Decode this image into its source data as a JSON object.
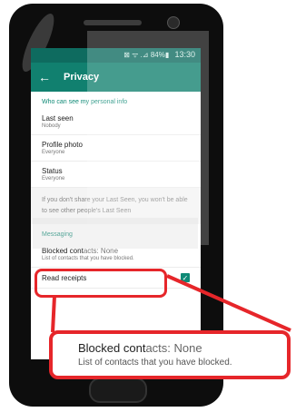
{
  "status_bar": {
    "icons_text": "⊠ ᯤ .⊿ 84%▮",
    "time": "13:30"
  },
  "toolbar": {
    "back_icon": "←",
    "title": "Privacy"
  },
  "sections": {
    "personal_header": "Who can see my personal info",
    "last_seen": {
      "title": "Last seen",
      "value": "Nobody"
    },
    "profile_photo": {
      "title": "Profile photo",
      "value": "Everyone"
    },
    "status": {
      "title": "Status",
      "value": "Everyone"
    },
    "note": "If you don't share your Last Seen, you won't be able to see other people's Last Seen",
    "messaging_header": "Messaging",
    "blocked_contacts": {
      "title_main": "Blocked cont",
      "title_dim": "acts: None",
      "subtitle": "List of contacts that you have blocked."
    },
    "read_receipts": {
      "title": "Read receipts",
      "check": "✓"
    }
  },
  "callout": {
    "title_main": "Blocked cont",
    "title_dim": "acts: None",
    "subtitle": "List of contacts that you have blocked."
  },
  "colors": {
    "accent": "#11806f",
    "highlight": "#e6262a"
  }
}
